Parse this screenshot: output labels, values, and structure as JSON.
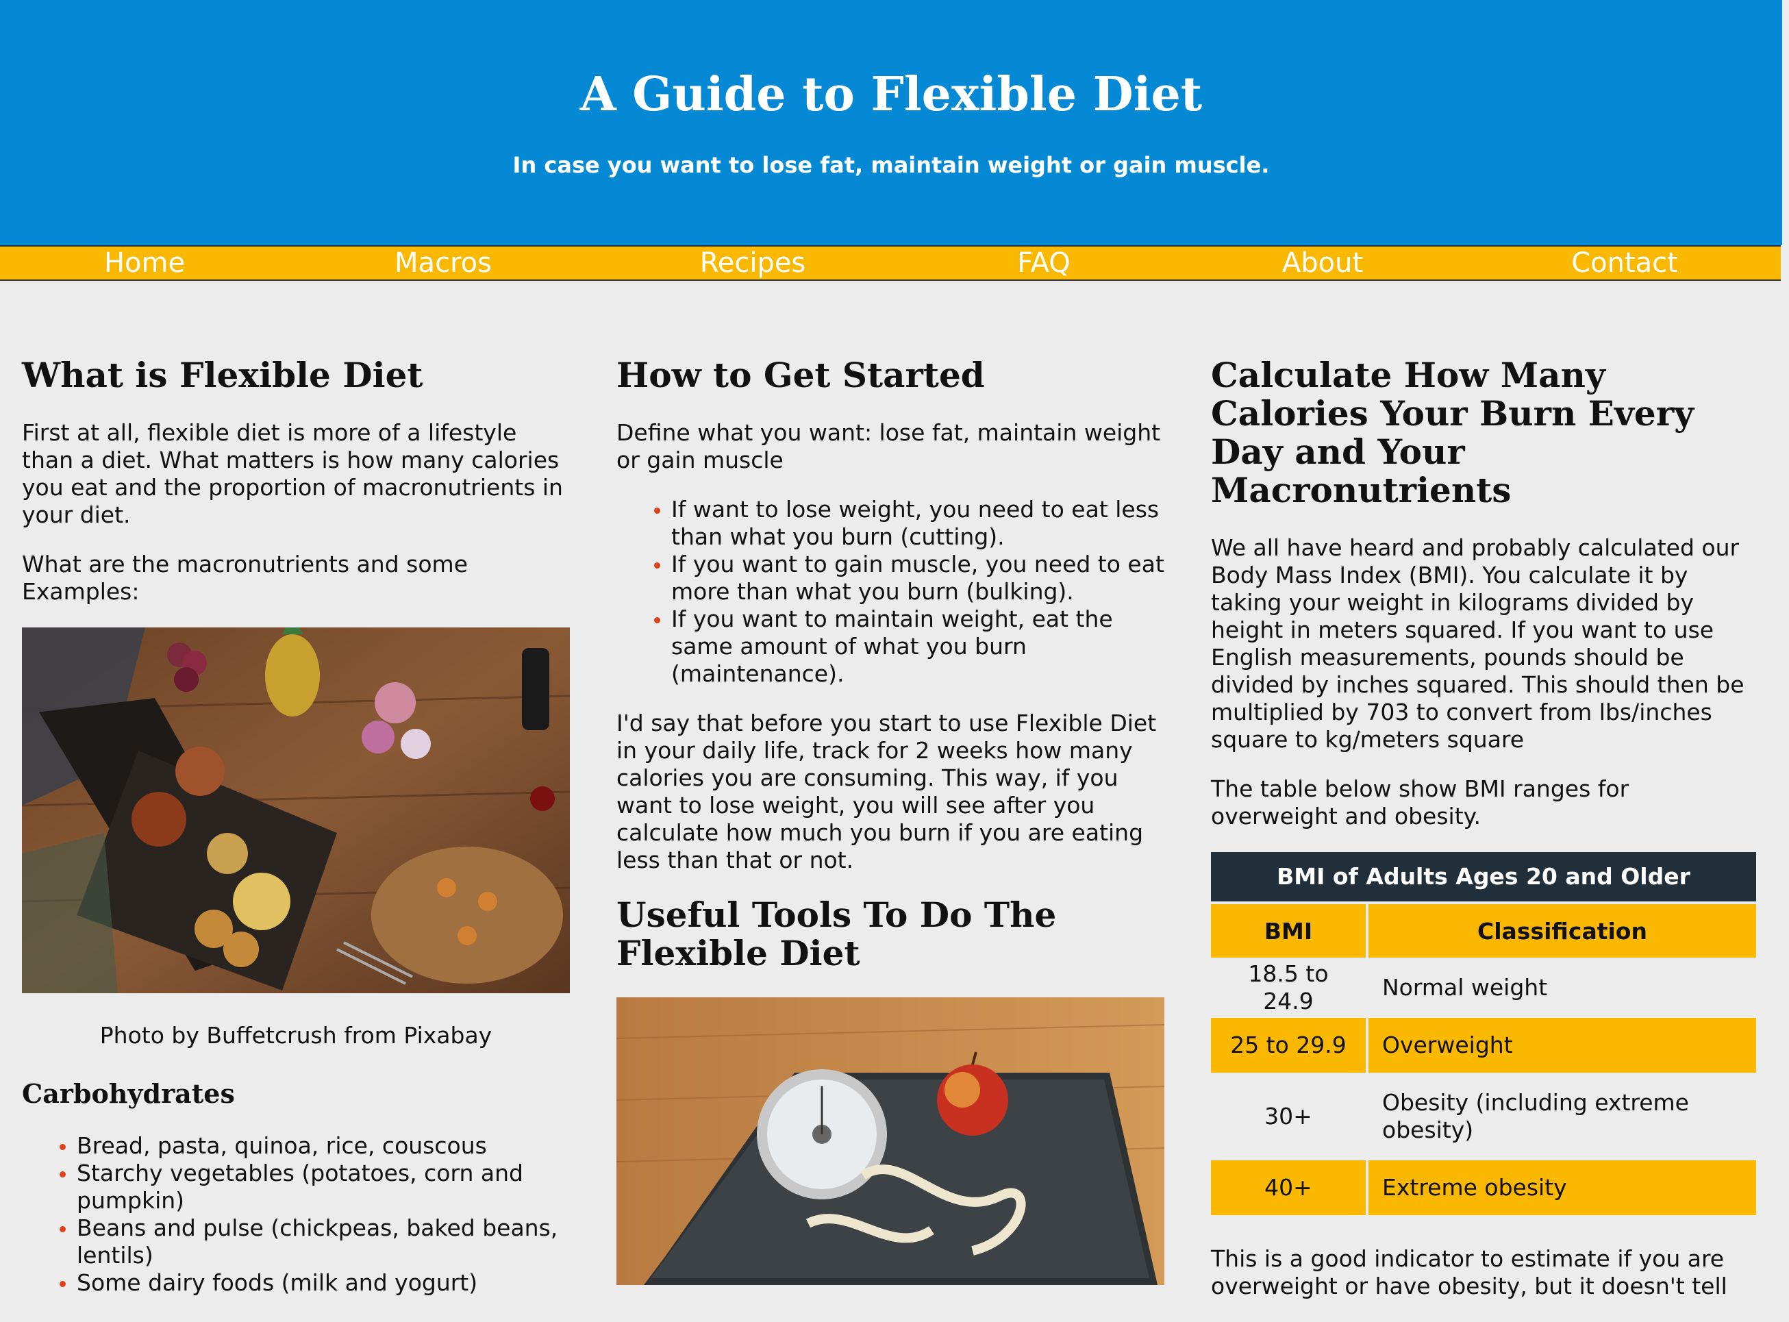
{
  "header": {
    "title": "A Guide to Flexible Diet",
    "subtitle": "In case you want to lose fat, maintain weight or gain muscle."
  },
  "nav": {
    "items": [
      "Home",
      "Macros",
      "Recipes",
      "FAQ",
      "About",
      "Contact"
    ]
  },
  "col1": {
    "heading": "What is Flexible Diet",
    "p1": "First at all, flexible diet is more of a lifestyle than a diet. What matters is how many calories you eat and the proportion of macronutrients in your diet.",
    "p2": "What are the macronutrients and some Examples:",
    "caption": "Photo by Buffetcrush from Pixabay",
    "carbs_heading": "Carbohydrates",
    "carbs": [
      "Bread, pasta, quinoa, rice, couscous",
      "Starchy vegetables (potatoes, corn and pumpkin)",
      "Beans and pulse (chickpeas, baked beans, lentils)",
      "Some dairy foods (milk and yogurt)"
    ]
  },
  "col2": {
    "heading": "How to Get Started",
    "p1": "Define what you want: lose fat, maintain weight or gain muscle",
    "bullets": [
      "If want to lose weight, you need to eat less than what you burn (cutting).",
      "If you want to gain muscle, you need to eat more than what you burn (bulking).",
      "If you want to maintain weight, eat the same amount of what you burn (maintenance)."
    ],
    "p2": "I'd say that before you start to use Flexible Diet in your daily life, track for 2 weeks how many calories you are consuming. This way, if you want to lose weight, you will see after you calculate how much you burn if you are eating less than that or not.",
    "heading2": "Useful Tools To Do The Flexible Diet"
  },
  "col3": {
    "heading": "Calculate How Many Calories Your Burn Every Day and Your Macronutrients",
    "p1": "We all have heard and probably calculated our Body Mass Index (BMI). You calculate it by taking your weight in kilograms divided by height in meters squared. If you want to use English measurements, pounds should be divided by inches squared. This should then be multiplied by 703 to convert from lbs/inches square to kg/meters square",
    "p2": "The table below show BMI ranges for overweight and obesity.",
    "table": {
      "caption": "BMI of Adults Ages 20 and Older",
      "headers": [
        "BMI",
        "Classification"
      ],
      "rows": [
        [
          "18.5 to 24.9",
          "Normal weight"
        ],
        [
          "25 to 29.9",
          "Overweight"
        ],
        [
          "30+",
          "Obesity (including extreme obesity)"
        ],
        [
          "40+",
          "Extreme obesity"
        ]
      ]
    },
    "p3": "This is a good indicator to estimate if you are overweight or have obesity, but it doesn't tell"
  },
  "colors": {
    "header_bg": "#0589d4",
    "nav_bg": "#fbb800",
    "accent_bullet": "#e0401a",
    "table_caption_bg": "#212f3a"
  }
}
